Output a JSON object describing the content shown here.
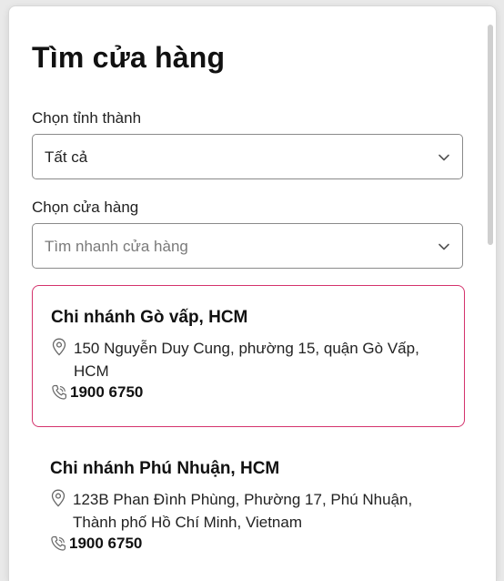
{
  "title": "Tìm cửa hàng",
  "province": {
    "label": "Chọn tỉnh thành",
    "selected": "Tất cả"
  },
  "store_select": {
    "label": "Chọn cửa hàng",
    "placeholder": "Tìm nhanh cửa hàng"
  },
  "stores": [
    {
      "name": "Chi nhánh Gò vấp, HCM",
      "address": "150 Nguyễn Duy Cung, phường 15, quận Gò Vấp, HCM",
      "phone": "1900 6750"
    },
    {
      "name": "Chi nhánh Phú Nhuận, HCM",
      "address": "123B Phan Đình Phùng, Phường 17, Phú Nhuận, Thành phố Hồ Chí Minh, Vietnam",
      "phone": "1900 6750"
    }
  ],
  "colors": {
    "active_border": "#d4336d",
    "input_border": "#8a8a8a"
  },
  "icons": {
    "select_arrow": "chevron-down-icon",
    "address": "map-pin-icon",
    "phone": "phone-icon"
  }
}
